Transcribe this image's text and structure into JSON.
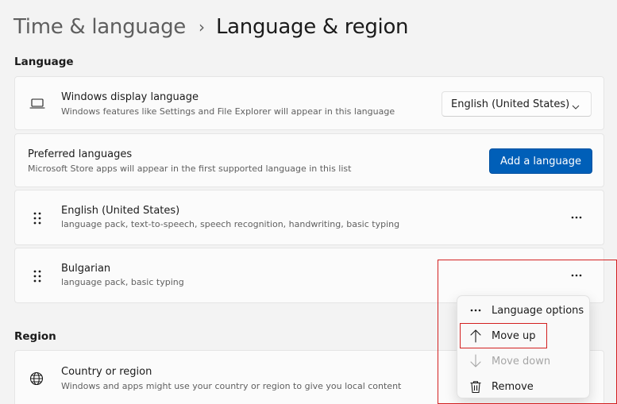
{
  "breadcrumb": {
    "parent": "Time & language",
    "separator": "›",
    "current": "Language & region"
  },
  "language_section": {
    "title": "Language",
    "display_language": {
      "title": "Windows display language",
      "subtitle": "Windows features like Settings and File Explorer will appear in this language",
      "selected": "English (United States)"
    },
    "preferred": {
      "title": "Preferred languages",
      "subtitle": "Microsoft Store apps will appear in the first supported language in this list",
      "add_button": "Add a language"
    },
    "languages": [
      {
        "name": "English (United States)",
        "features": "language pack, text-to-speech, speech recognition, handwriting, basic typing"
      },
      {
        "name": "Bulgarian",
        "features": "language pack, basic typing"
      }
    ],
    "more_label": "···"
  },
  "context_menu": {
    "items": [
      {
        "label": "Language options",
        "icon": "more-horizontal-icon",
        "enabled": true
      },
      {
        "label": "Move up",
        "icon": "arrow-up-icon",
        "enabled": true
      },
      {
        "label": "Move down",
        "icon": "arrow-down-icon",
        "enabled": false
      },
      {
        "label": "Remove",
        "icon": "trash-icon",
        "enabled": true
      }
    ]
  },
  "region_section": {
    "title": "Region",
    "country": {
      "title": "Country or region",
      "subtitle": "Windows and apps might use your country or region to give you local content"
    }
  },
  "colors": {
    "accent": "#005fb8",
    "highlight": "#d32020",
    "background": "#f3f3f3",
    "card": "#fbfbfb"
  }
}
